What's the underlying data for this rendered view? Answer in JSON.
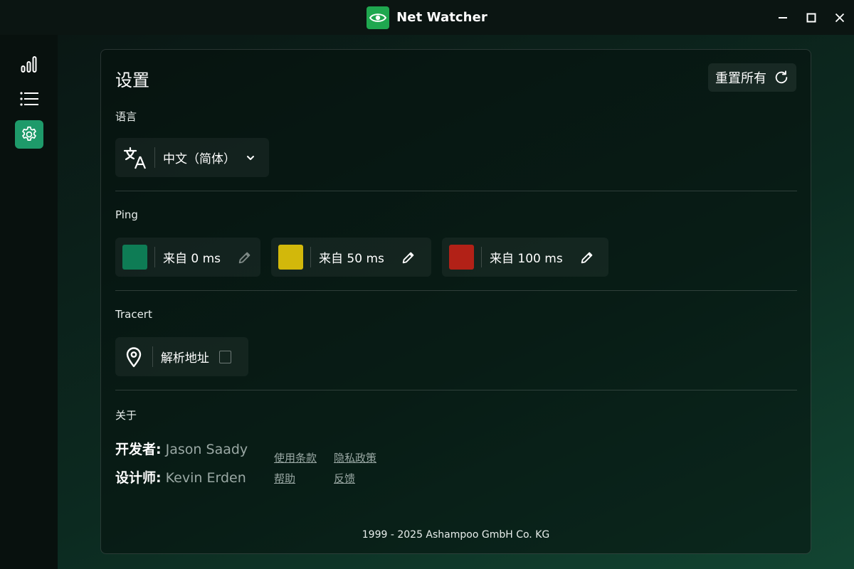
{
  "app": {
    "title": "Net Watcher"
  },
  "settings": {
    "title": "设置",
    "reset_label": "重置所有",
    "language": {
      "label": "语言",
      "selected": "中文（简体）"
    },
    "ping": {
      "label": "Ping",
      "thresholds": [
        {
          "text": "来自 0 ms",
          "color": "#0e7c55"
        },
        {
          "text": "来自 50 ms",
          "color": "#d2b80b"
        },
        {
          "text": "来自 100 ms",
          "color": "#b22117"
        }
      ]
    },
    "tracert": {
      "label": "Tracert",
      "resolve_label": "解析地址"
    },
    "about": {
      "label": "关于",
      "developer_key": "开发者:",
      "developer": "Jason Saady",
      "designer_key": "设计师:",
      "designer": "Kevin Erden",
      "links": {
        "terms": "使用条款",
        "privacy": "隐私政策",
        "help": "帮助",
        "feedback": "反馈"
      }
    },
    "copyright": "1999 - 2025 Ashampoo GmbH Co. KG"
  },
  "colors": {
    "accent": "#1fa74f",
    "nav_active": "#1e9a6a"
  }
}
